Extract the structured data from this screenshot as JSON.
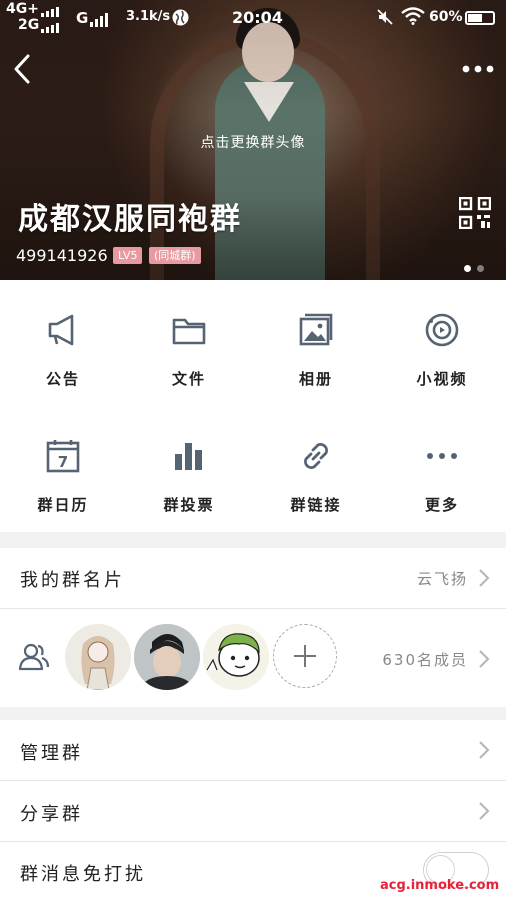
{
  "status_bar": {
    "network_top": "4G+",
    "network_bottom": "2G",
    "network_g": "G",
    "speed": "3.1k/s",
    "time": "20:04",
    "battery": "60%",
    "battery_level": 0.6
  },
  "header": {
    "change_avatar_hint": "点击更换群头像",
    "group_name": "成都汉服同袍群",
    "group_id": "499141926",
    "level_badge": "LV5",
    "tag_badge": "(同城群)",
    "page_dots": 2,
    "active_dot": 0
  },
  "grid": [
    {
      "label": "公告",
      "icon": "megaphone-icon"
    },
    {
      "label": "文件",
      "icon": "folder-icon"
    },
    {
      "label": "相册",
      "icon": "album-icon"
    },
    {
      "label": "小视频",
      "icon": "video-icon"
    },
    {
      "label": "群日历",
      "icon": "calendar-icon",
      "icon_text": "7"
    },
    {
      "label": "群投票",
      "icon": "bar-chart-icon"
    },
    {
      "label": "群链接",
      "icon": "link-icon"
    },
    {
      "label": "更多",
      "icon": "more-dots-icon"
    }
  ],
  "my_card": {
    "title": "我的群名片",
    "value": "云飞扬"
  },
  "members": {
    "count_text": "630名成员"
  },
  "manage": {
    "title": "管理群"
  },
  "share": {
    "title": "分享群"
  },
  "mute": {
    "title": "群消息免打扰",
    "enabled": false
  },
  "watermark": "acg.inmoke.com",
  "colors": {
    "badge": "#e79aa1",
    "watermark": "#e8223a"
  }
}
